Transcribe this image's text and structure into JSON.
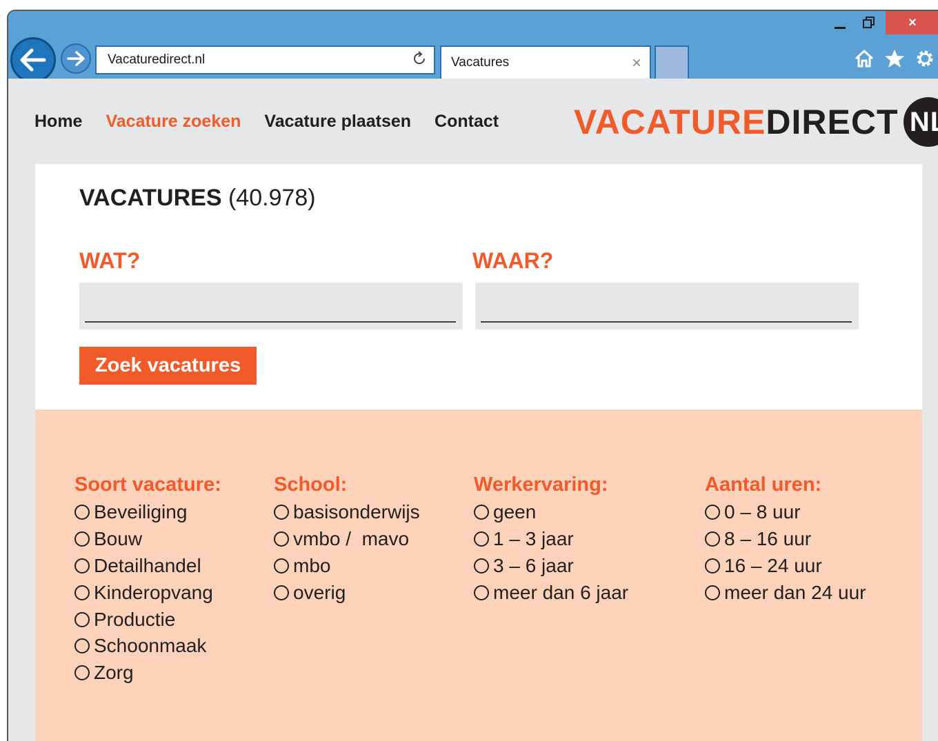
{
  "browser": {
    "url": "Vacaturedirect.nl",
    "tab_title": "Vacatures",
    "controls": {
      "minimize": "–",
      "close": "×"
    }
  },
  "site": {
    "menu": [
      {
        "label": "Home",
        "active": false
      },
      {
        "label": "Vacature zoeken",
        "active": true
      },
      {
        "label": "Vacature plaatsen",
        "active": false
      },
      {
        "label": "Contact",
        "active": false
      }
    ],
    "logo": {
      "part1": "VACATURE",
      "part2": "DIRECT",
      "part3": "NL"
    }
  },
  "search": {
    "title": "VACATURES",
    "count": "(40.978)",
    "what_label": "WAT?",
    "where_label": "WAAR?",
    "what_value": "",
    "where_value": "",
    "button_label": "Zoek vacatures"
  },
  "filters": [
    {
      "title": "Soort vacature:",
      "options": [
        "Beveiliging",
        "Bouw",
        "Detailhandel",
        "Kinderopvang",
        "Productie",
        "Schoonmaak",
        "Zorg"
      ]
    },
    {
      "title": "School:",
      "options": [
        "basisonderwijs",
        "vmbo /  mavo",
        "mbo",
        "overig"
      ]
    },
    {
      "title": "Werkervaring:",
      "options": [
        "geen",
        "1 – 3 jaar",
        "3 – 6 jaar",
        "meer dan 6 jaar"
      ]
    },
    {
      "title": "Aantal uren:",
      "options": [
        "0 – 8 uur",
        "8 – 16 uur",
        "16 – 24 uur",
        "meer dan 24 uur"
      ]
    }
  ],
  "colors": {
    "accent": "#f15a29",
    "titlebar": "#5ba1d6",
    "filters_bg": "#fcd2bb"
  }
}
